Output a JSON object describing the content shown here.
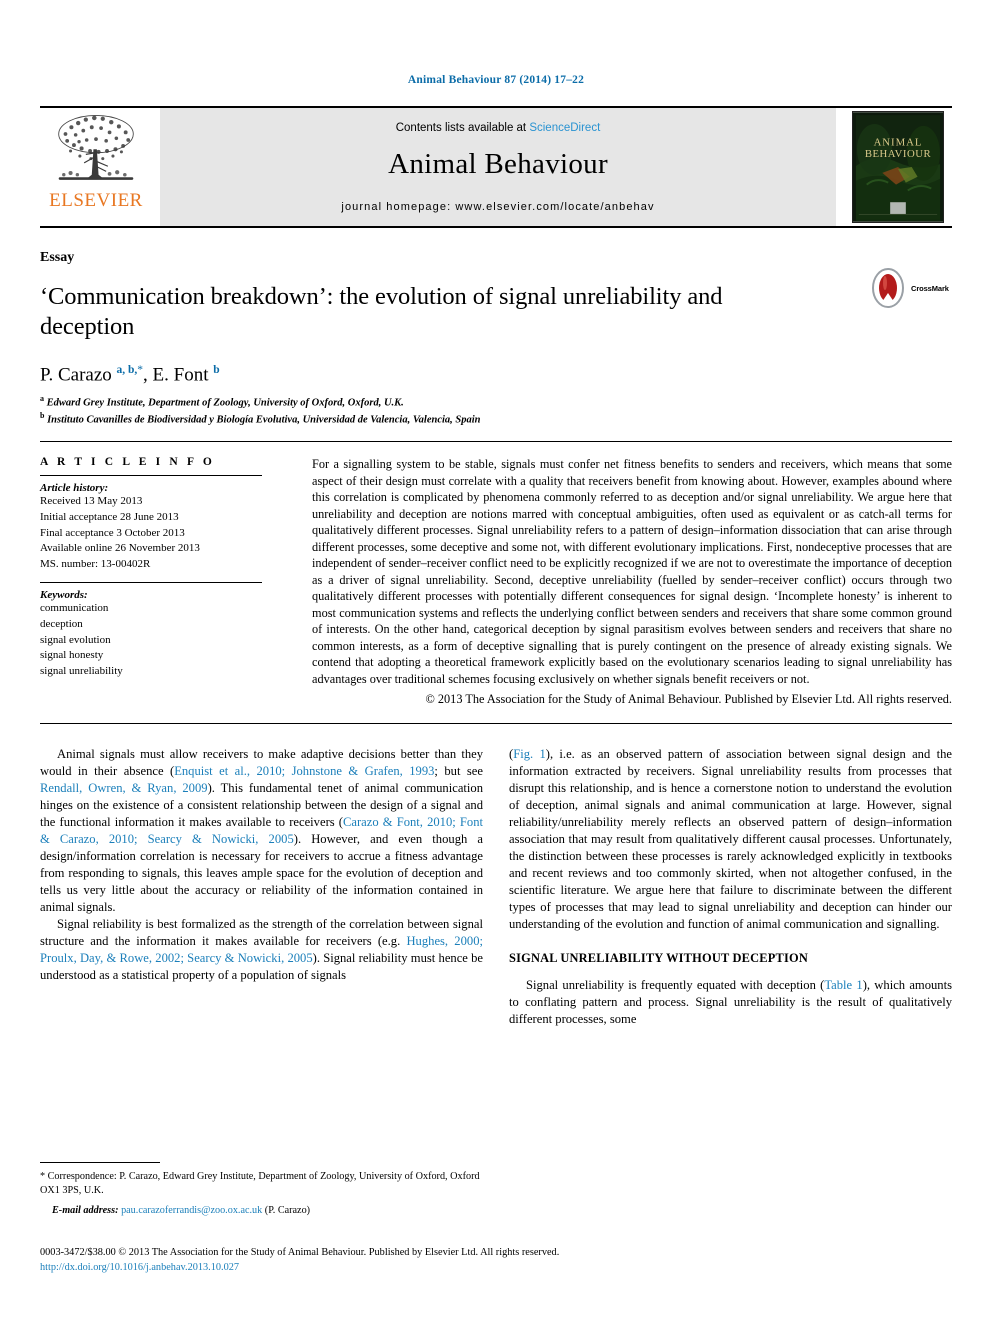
{
  "running_head": "Animal Behaviour 87 (2014) 17–22",
  "masthead": {
    "publisher_name": "ELSEVIER",
    "contents_prefix": "Contents lists available at ",
    "contents_link": "ScienceDirect",
    "journal_title": "Animal Behaviour",
    "homepage": "journal homepage: www.elsevier.com/locate/anbehav",
    "cover_title_line1": "ANIMAL",
    "cover_title_line2": "BEHAVIOUR"
  },
  "article": {
    "type": "Essay",
    "title": "‘Communication breakdown’: the evolution of signal unreliability and deception",
    "crossmark_label": "CrossMark",
    "authors_html": "P. Carazo <sup>a, b,</sup><sup class=\"ast\">*</sup>, E. Font <sup>b</sup>",
    "affiliation_a": "Edward Grey Institute, Department of Zoology, University of Oxford, Oxford, U.K.",
    "affiliation_b": "Instituto Cavanilles de Biodiversidad y Biología Evolutiva, Universidad de Valencia, Valencia, Spain"
  },
  "info": {
    "heading": "A R T I C L E  I N F O",
    "history_label": "Article history:",
    "history": [
      "Received 13 May 2013",
      "Initial acceptance 28 June 2013",
      "Final acceptance 3 October 2013",
      "Available online 26 November 2013",
      "MS. number: 13-00402R"
    ],
    "keywords_label": "Keywords:",
    "keywords": [
      "communication",
      "deception",
      "signal evolution",
      "signal honesty",
      "signal unreliability"
    ]
  },
  "abstract": {
    "text": "For a signalling system to be stable, signals must confer net fitness benefits to senders and receivers, which means that some aspect of their design must correlate with a quality that receivers benefit from knowing about. However, examples abound where this correlation is complicated by phenomena commonly referred to as deception and/or signal unreliability. We argue here that unreliability and deception are notions marred with conceptual ambiguities, often used as equivalent or as catch-all terms for qualitatively different processes. Signal unreliability refers to a pattern of design–information dissociation that can arise through different processes, some deceptive and some not, with different evolutionary implications. First, nondeceptive processes that are independent of sender–receiver conflict need to be explicitly recognized if we are not to overestimate the importance of deception as a driver of signal unreliability. Second, deceptive unreliability (fuelled by sender–receiver conflict) occurs through two qualitatively different processes with potentially different consequences for signal design. ‘Incomplete honesty’ is inherent to most communication systems and reflects the underlying conflict between senders and receivers that share some common ground of interests. On the other hand, categorical deception by signal parasitism evolves between senders and receivers that share no common interests, as a form of deceptive signalling that is purely contingent on the presence of already existing signals. We contend that adopting a theoretical framework explicitly based on the evolutionary scenarios leading to signal unreliability has advantages over traditional schemes focusing exclusively on whether signals benefit receivers or not.",
    "copyright": "© 2013 The Association for the Study of Animal Behaviour. Published by Elsevier Ltd. All rights reserved."
  },
  "body": {
    "left_p1_a": "Animal signals must allow receivers to make adaptive decisions better than they would in their absence (",
    "left_p1_ref1": "Enquist et al., 2010; Johnstone & Grafen, 1993",
    "left_p1_b": "; but see ",
    "left_p1_ref2": "Rendall, Owren, & Ryan, 2009",
    "left_p1_c": "). This fundamental tenet of animal communication hinges on the existence of a consistent relationship between the design of a signal and the functional information it makes available to receivers (",
    "left_p1_ref3": "Carazo & Font, 2010; Font & Carazo, 2010; Searcy & Nowicki, 2005",
    "left_p1_d": "). However, and even though a design/information correlation is necessary for receivers to accrue a fitness advantage from responding to signals, this leaves ample space for the evolution of deception and tells us very little about the accuracy or reliability of the information contained in animal signals.",
    "left_p2_a": "Signal reliability is best formalized as the strength of the correlation between signal structure and the information it makes available for receivers (e.g. ",
    "left_p2_ref1": "Hughes, 2000; Proulx, Day, & Rowe, 2002; Searcy & Nowicki, 2005",
    "left_p2_b": "). Signal reliability must hence be understood as a statistical property of a population of signals",
    "right_p1_a": "(",
    "right_p1_ref1": "Fig. 1",
    "right_p1_b": "), i.e. as an observed pattern of association between signal design and the information extracted by receivers. Signal unreliability results from processes that disrupt this relationship, and is hence a cornerstone notion to understand the evolution of deception, animal signals and animal communication at large. However, signal reliability/unreliability merely reflects an observed pattern of design–information association that may result from qualitatively different causal processes. Unfortunately, the distinction between these processes is rarely acknowledged explicitly in textbooks and recent reviews and too commonly skirted, when not altogether confused, in the scientific literature. We argue here that failure to discriminate between the different types of processes that may lead to signal unreliability and deception can hinder our understanding of the evolution and function of animal communication and signalling.",
    "section_heading": "Signal unreliability without deception",
    "right_p2_a": "Signal unreliability is frequently equated with deception (",
    "right_p2_ref1": "Table 1",
    "right_p2_b": "), which amounts to conflating pattern and process. Signal unreliability is the result of qualitatively different processes, some"
  },
  "footnotes": {
    "correspondence": "* Correspondence: P. Carazo, Edward Grey Institute, Department of Zoology, University of Oxford, Oxford OX1 3PS, U.K.",
    "email_label": "E-mail address:",
    "email": "pau.carazoferrandis@zoo.ox.ac.uk",
    "email_suffix": "(P. Carazo)"
  },
  "footer": {
    "issn_line": "0003-3472/$38.00 © 2013 The Association for the Study of Animal Behaviour. Published by Elsevier Ltd. All rights reserved.",
    "doi": "http://dx.doi.org/10.1016/j.anbehav.2013.10.027"
  },
  "colors": {
    "link_blue": "#1b7fba",
    "running_head_blue": "#0b6ca8",
    "elsevier_orange": "#e87722",
    "masthead_grey": "#e6e6e6"
  }
}
